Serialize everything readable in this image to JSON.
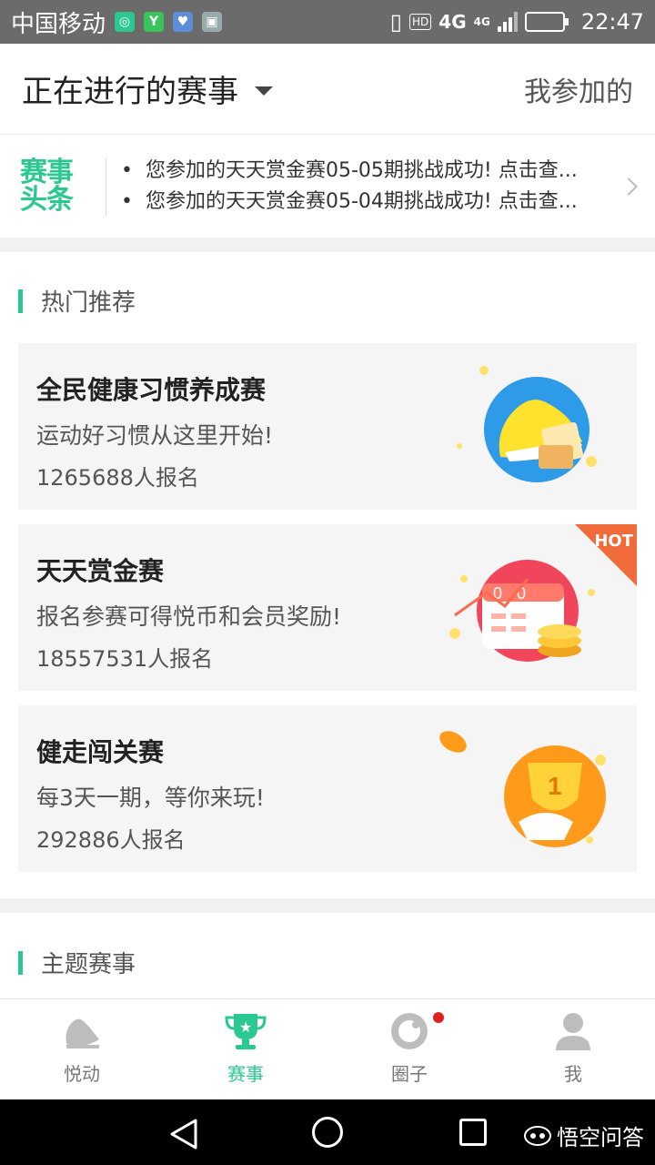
{
  "status_bar": {
    "carrier": "中国移动",
    "network": "4G",
    "network2": "4G",
    "hd": "HD",
    "time": "22:47"
  },
  "header": {
    "title": "正在进行的赛事",
    "right_link": "我参加的"
  },
  "news": {
    "logo_line1": "赛事",
    "logo_line2": "头条",
    "items": [
      "您参加的天天赏金赛05-05期挑战成功! 点击查...",
      "您参加的天天赏金赛05-04期挑战成功! 点击查..."
    ]
  },
  "hot_section": {
    "title": "热门推荐",
    "cards": [
      {
        "name": "全民健康习惯养成赛",
        "desc": "运动好习惯从这里开始!",
        "count": "1265688人报名"
      },
      {
        "name": "天天赏金赛",
        "desc": "报名参赛可得悦币和会员奖励!",
        "count": "18557531人报名",
        "badge": "HOT"
      },
      {
        "name": "健走闯关赛",
        "desc": "每3天一期，等你来玩!",
        "count": "292886人报名"
      }
    ]
  },
  "theme_section": {
    "title": "主题赛事"
  },
  "tabbar": {
    "tabs": [
      {
        "label": "悦动",
        "icon": "shoe-icon"
      },
      {
        "label": "赛事",
        "icon": "trophy-icon"
      },
      {
        "label": "圈子",
        "icon": "circle-icon"
      },
      {
        "label": "我",
        "icon": "user-icon"
      }
    ]
  },
  "watermark": "悟空问答",
  "colors": {
    "accent": "#2bc990",
    "hot": "#f06a3a",
    "statusbar": "#6b6b6b"
  }
}
